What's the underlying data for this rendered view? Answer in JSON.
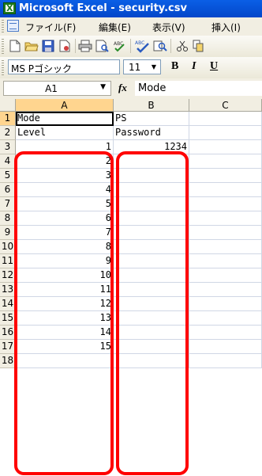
{
  "window": {
    "title": "Microsoft Excel - security.csv"
  },
  "menu": {
    "items": [
      "ファイル(F)",
      "編集(E)",
      "表示(V)",
      "挿入(I)"
    ]
  },
  "toolbar": {
    "icons": [
      "new-icon",
      "open-icon",
      "save-icon",
      "permission-icon",
      "print-icon",
      "print-preview-icon",
      "spelling-icon",
      "research-icon",
      "cut-icon",
      "copy-icon"
    ]
  },
  "format": {
    "font": "MS Pゴシック",
    "size": "11",
    "bold": "B",
    "italic": "I",
    "underline": "U"
  },
  "formula": {
    "cell_ref": "A1",
    "fx": "fx",
    "value": "Mode"
  },
  "sheet": {
    "columns": [
      "A",
      "B",
      "C"
    ],
    "rows": [
      {
        "n": "1",
        "a": "Mode",
        "b": "PS"
      },
      {
        "n": "2",
        "a": "Level",
        "b": "Password"
      },
      {
        "n": "3",
        "a": "1",
        "b": "1234"
      },
      {
        "n": "4",
        "a": "2",
        "b": ""
      },
      {
        "n": "5",
        "a": "3",
        "b": ""
      },
      {
        "n": "6",
        "a": "4",
        "b": ""
      },
      {
        "n": "7",
        "a": "5",
        "b": ""
      },
      {
        "n": "8",
        "a": "6",
        "b": ""
      },
      {
        "n": "9",
        "a": "7",
        "b": ""
      },
      {
        "n": "10",
        "a": "8",
        "b": ""
      },
      {
        "n": "11",
        "a": "9",
        "b": ""
      },
      {
        "n": "12",
        "a": "10",
        "b": ""
      },
      {
        "n": "13",
        "a": "11",
        "b": ""
      },
      {
        "n": "14",
        "a": "12",
        "b": ""
      },
      {
        "n": "15",
        "a": "13",
        "b": ""
      },
      {
        "n": "16",
        "a": "14",
        "b": ""
      },
      {
        "n": "17",
        "a": "15",
        "b": ""
      },
      {
        "n": "18",
        "a": "",
        "b": ""
      }
    ]
  },
  "colors": {
    "title_bar": "#0346c9",
    "highlight": "#ff0000",
    "chrome": "#f1eee2"
  }
}
